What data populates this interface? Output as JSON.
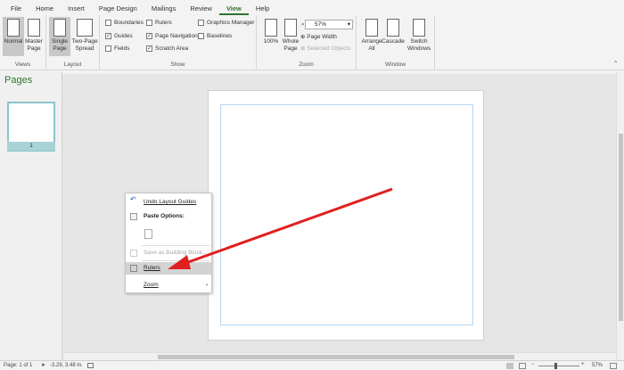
{
  "tabs": [
    "File",
    "Home",
    "Insert",
    "Page Design",
    "Mailings",
    "Review",
    "View",
    "Help"
  ],
  "active_tab": "View",
  "views": {
    "normal": "Normal",
    "master": "Master Page",
    "label": "Views"
  },
  "layout": {
    "single": "Single Page",
    "two": "Two-Page Spread",
    "label": "Layout"
  },
  "show": {
    "label": "Show",
    "boundaries": "Boundaries",
    "guides": "Guides",
    "fields": "Fields",
    "rulers": "Rulers",
    "page_navigation": "Page Navigation",
    "scratch_area": "Scratch Area",
    "graphics_manager": "Graphics Manager",
    "baselines": "Baselines"
  },
  "zoom": {
    "label": "Zoom",
    "p100": "100%",
    "whole": "Whole Page",
    "value": "57%",
    "page_width": "Page Width",
    "selected": "Selected Objects"
  },
  "window": {
    "label": "Window",
    "arrange": "Arrange All",
    "cascade": "Cascade",
    "switch": "Switch Windows"
  },
  "pages_title": "Pages",
  "page_number": "1",
  "context_menu": {
    "undo": "Undo Layout Guides",
    "paste_options": "Paste Options:",
    "save_block": "Save as Building Block...",
    "rulers": "Rulers",
    "zoom": "Zoom"
  },
  "status": {
    "page": "Page: 1 of 1",
    "coords": "-3.29, 3.48 in.",
    "zoom": "57%"
  },
  "colors": {
    "accent": "#31752f",
    "arrow": "#e02020"
  }
}
